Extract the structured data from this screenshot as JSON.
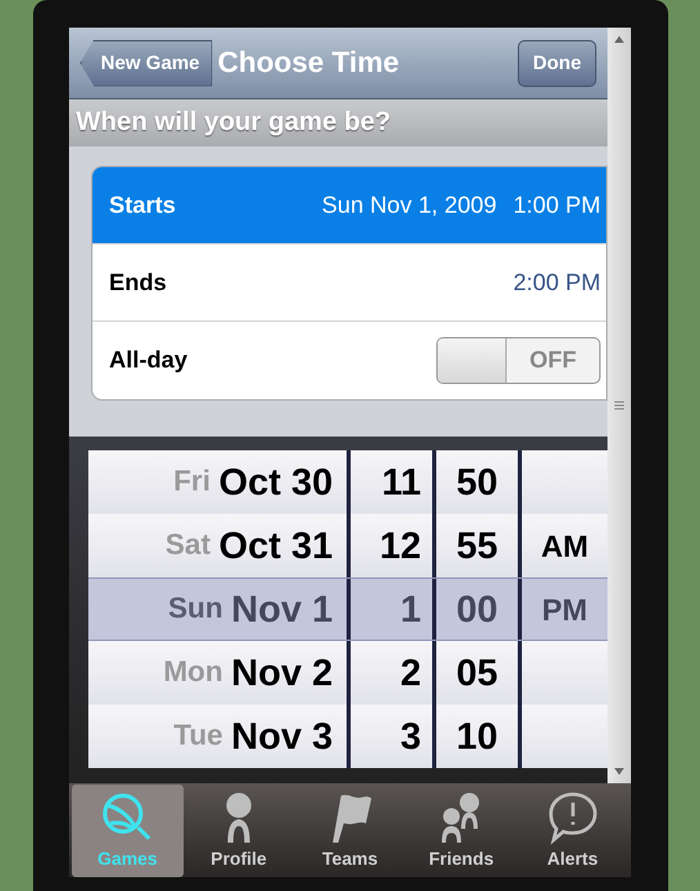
{
  "nav": {
    "back": "New Game",
    "title": "Choose Time",
    "done": "Done"
  },
  "prompt": "When will your game be?",
  "rows": [
    {
      "kind": "value",
      "label": "Starts",
      "date": "Sun Nov 1, 2009",
      "time": "1:00 PM",
      "selected": true
    },
    {
      "kind": "value",
      "label": "Ends",
      "time": "2:00 PM",
      "selected": false
    },
    {
      "kind": "toggle",
      "label": "All-day",
      "on": false,
      "state_text": "OFF"
    }
  ],
  "picker": [
    {
      "weekday": "Fri",
      "date": "Oct 30",
      "hour": "11",
      "minute": "50",
      "selected": false
    },
    {
      "weekday": "Sat",
      "date": "Oct 31",
      "hour": "12",
      "minute": "55",
      "period": "AM",
      "selected": false
    },
    {
      "weekday": "Sun",
      "date": "Nov 1",
      "hour": "1",
      "minute": "00",
      "period": "PM",
      "selected": true
    },
    {
      "weekday": "Mon",
      "date": "Nov 2",
      "hour": "2",
      "minute": "05",
      "selected": false
    },
    {
      "weekday": "Tue",
      "date": "Nov 3",
      "hour": "3",
      "minute": "10",
      "selected": false
    }
  ],
  "tabs": [
    {
      "label": "Games",
      "selected": true
    },
    {
      "label": "Profile",
      "selected": false
    },
    {
      "label": "Teams",
      "selected": false
    },
    {
      "label": "Friends",
      "selected": false
    },
    {
      "label": "Alerts",
      "selected": false
    }
  ]
}
